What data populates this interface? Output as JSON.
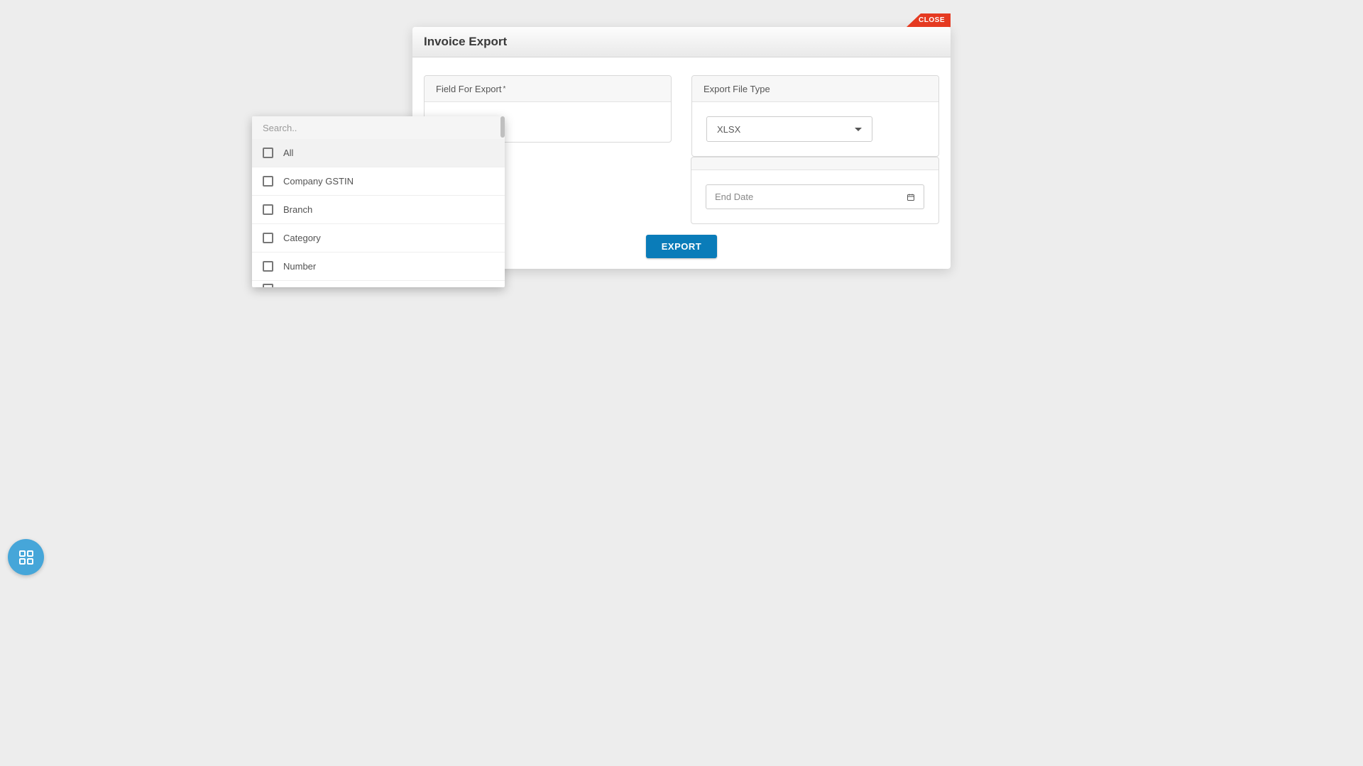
{
  "close_label": "CLOSE",
  "modal_title": "Invoice Export",
  "field_for_export": {
    "header": "Field For Export",
    "asterisk": "*",
    "search_placeholder": "Search..",
    "options": [
      {
        "label": "All",
        "highlight": true
      },
      {
        "label": "Company GSTIN",
        "highlight": false
      },
      {
        "label": "Branch",
        "highlight": false
      },
      {
        "label": "Category",
        "highlight": false
      },
      {
        "label": "Number",
        "highlight": false
      }
    ]
  },
  "export_file_type": {
    "header": "Export File Type",
    "value": "XLSX"
  },
  "end_date_placeholder": "End Date",
  "export_button": "EXPORT"
}
